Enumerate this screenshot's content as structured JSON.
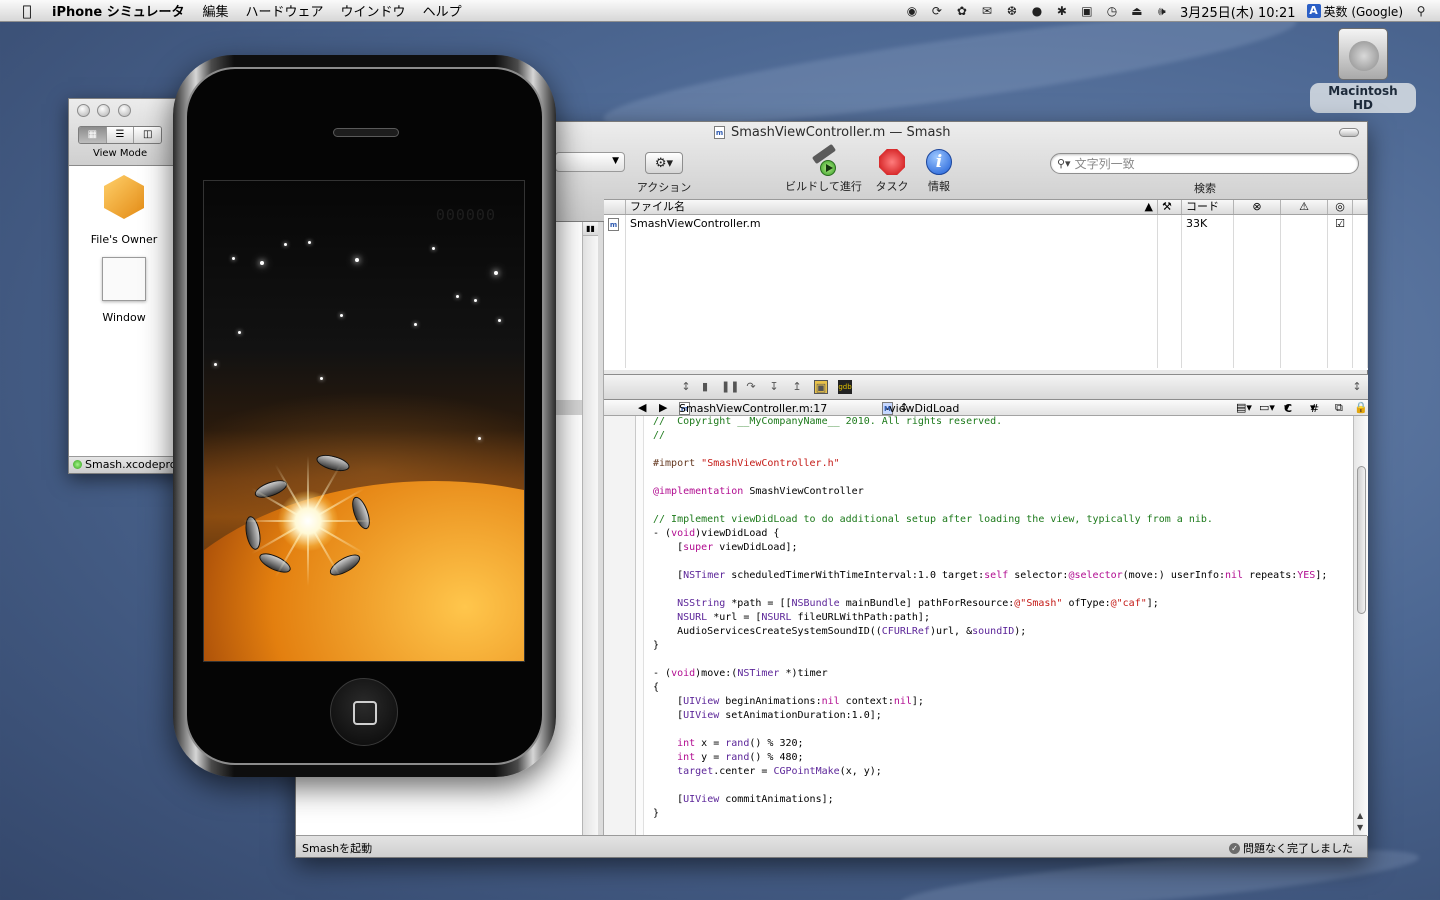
{
  "menubar": {
    "app_name": "iPhone シミュレータ",
    "menus": [
      "編集",
      "ハードウェア",
      "ウインドウ",
      "ヘルプ"
    ],
    "clock": "3月25日(木) 10:21",
    "input_method": "英数 (Google)"
  },
  "desktop": {
    "hd_label": "Macintosh HD"
  },
  "ib_window": {
    "view_mode_label": "View Mode",
    "items": [
      "File's Owner",
      "Window"
    ],
    "status": "Smash.xcodeproj",
    "peek_letter": "F"
  },
  "xcode": {
    "title": "SmashViewController.m — Smash",
    "toolbar": {
      "action": "アクション",
      "build_and_run": "ビルドして進行",
      "tasks": "タスク",
      "info": "情報",
      "search_placeholder": "文字列一致",
      "search_label": "検索"
    },
    "table": {
      "headers": {
        "file_name": "ファイル名",
        "code": "コード"
      },
      "rows": [
        {
          "name": "SmashViewController.m",
          "code": "33K"
        }
      ]
    },
    "editor_nav": {
      "file": "SmashViewController.m:17",
      "symbol": "-viewDidLoad",
      "c_popup": "C",
      "hash_popup": "#"
    },
    "status_left": "Smashを起動",
    "status_right": "問題なく完了しました"
  },
  "simulator": {
    "score": "000000"
  },
  "colors": {
    "comment": "#1d7a1b",
    "keyword": "#b10c90",
    "string": "#c41a16",
    "type": "#5c2699",
    "preprocessor": "#643820"
  }
}
